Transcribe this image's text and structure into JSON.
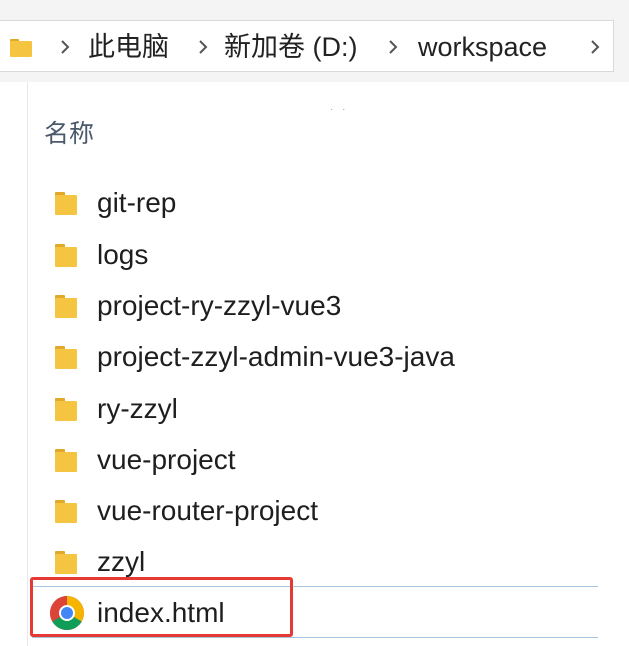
{
  "address_bar": {
    "crumbs": [
      "此电脑",
      "新加卷 (D:)",
      "workspace"
    ]
  },
  "list": {
    "column_header": "名称",
    "items": [
      {
        "label": "git-rep",
        "icon": "folder-icon"
      },
      {
        "label": "logs",
        "icon": "folder-icon"
      },
      {
        "label": "project-ry-zzyl-vue3",
        "icon": "folder-icon"
      },
      {
        "label": "project-zzyl-admin-vue3-java",
        "icon": "folder-icon"
      },
      {
        "label": "ry-zzyl",
        "icon": "folder-icon"
      },
      {
        "label": "vue-project",
        "icon": "folder-icon"
      },
      {
        "label": "vue-router-project",
        "icon": "folder-icon"
      },
      {
        "label": "zzyl",
        "icon": "folder-icon"
      },
      {
        "label": "index.html",
        "icon": "chrome-icon",
        "selected": true
      }
    ]
  },
  "colors": {
    "folder": "#f5c542",
    "folder_dark": "#e0a92a",
    "highlight": "#e53935",
    "selection_border": "#a7c4e0"
  }
}
